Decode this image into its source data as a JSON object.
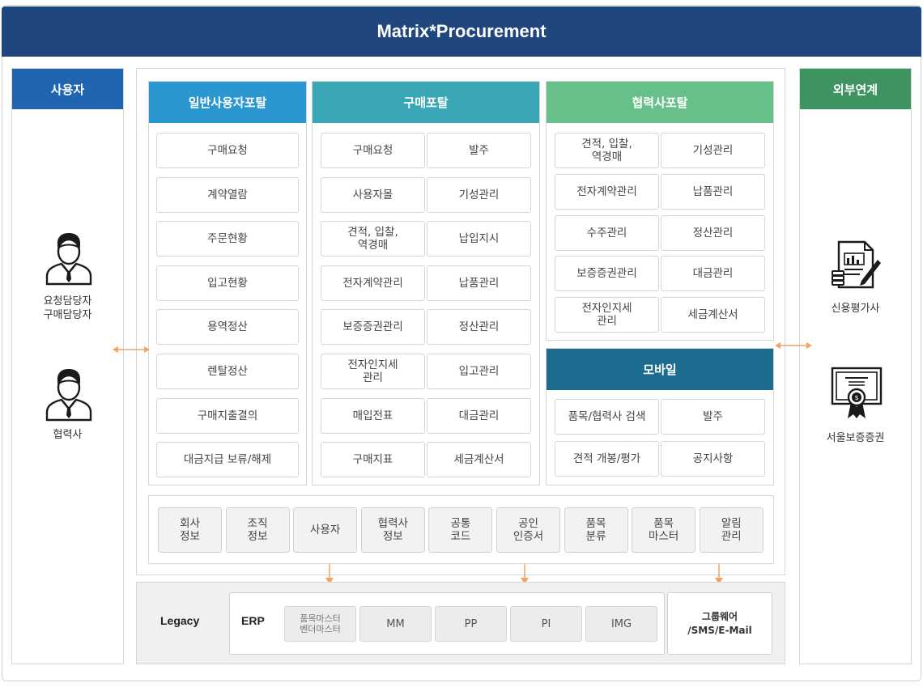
{
  "title": "Matrix*Procurement",
  "users": {
    "header": "사용자",
    "groups": [
      {
        "icon": "person-icon",
        "label": "요청담당자\n구매담당자"
      },
      {
        "icon": "person-icon",
        "label": "협력사"
      }
    ]
  },
  "external": {
    "header": "외부연계",
    "items": [
      {
        "icon": "report-pen-icon",
        "label": "신용평가사"
      },
      {
        "icon": "certificate-icon",
        "label": "서울보증증권"
      }
    ]
  },
  "general_portal": {
    "title": "일반사용자포탈",
    "items": [
      "구매요청",
      "계약열람",
      "주문현황",
      "입고현황",
      "용역정산",
      "렌탈정산",
      "구매지출결의",
      "대금지급 보류/해제"
    ]
  },
  "purchase_portal": {
    "title": "구매포탈",
    "items": [
      "구매요청",
      "발주",
      "사용자몰",
      "기성관리",
      "견적, 입찰,\n역경매",
      "납입지시",
      "전자계약관리",
      "납품관리",
      "보증증권관리",
      "정산관리",
      "전자인지세\n관리",
      "입고관리",
      "매입전표",
      "대금관리",
      "구매지표",
      "세금계산서"
    ]
  },
  "partner_portal": {
    "title": "협력사포탈",
    "items": [
      "견적, 입찰,\n역경매",
      "기성관리",
      "전자계약관리",
      "납품관리",
      "수주관리",
      "정산관리",
      "보증증권관리",
      "대금관리",
      "전자인지세\n관리",
      "세금계산서"
    ]
  },
  "mobile": {
    "title": "모바일",
    "items": [
      "품목/협력사 검색",
      "발주",
      "견적 개봉/평가",
      "공지사항"
    ]
  },
  "common": {
    "items": [
      "회사\n정보",
      "조직\n정보",
      "사용자",
      "협력사\n정보",
      "공통\n코드",
      "공인\n인증서",
      "품목\n분류",
      "품목\n마스터",
      "알림\n관리"
    ]
  },
  "legacy": {
    "label": "Legacy",
    "erp_label": "ERP",
    "erp_modules": [
      "품목마스터\n벤더마스터",
      "MM",
      "PP",
      "PI",
      "IMG"
    ],
    "groupware": "그룹웨어\n/SMS/E-Mail"
  },
  "colors": {
    "banner": "#1f477d",
    "users_header": "#1f65b0",
    "external_header": "#3e9460",
    "general_portal": "#2a97d0",
    "purchase_portal": "#3aa7b6",
    "partner_portal": "#67c08a",
    "mobile": "#1b6c8f",
    "arrow": "#f3a464"
  }
}
